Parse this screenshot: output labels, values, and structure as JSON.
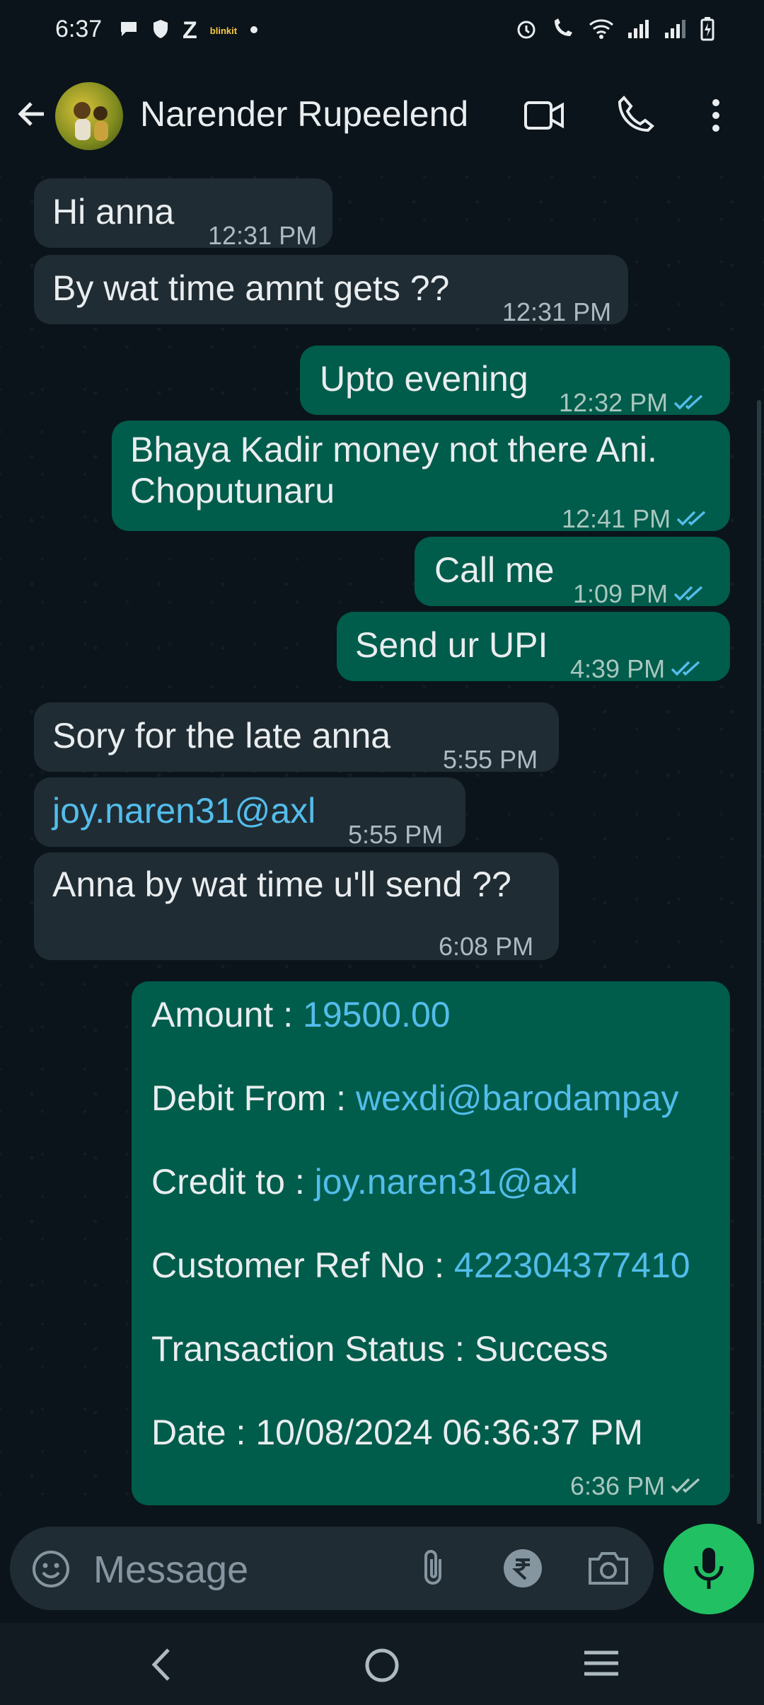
{
  "status_bar": {
    "time": "6:37",
    "left_icons": [
      "chat-bubble-icon",
      "shield-icon",
      "zomato-icon",
      "blinkit-icon",
      "dot-icon"
    ],
    "blinkit_label": "blinkit",
    "zomato_label": "Z",
    "right_icons": [
      "alarm-icon",
      "volte-call-icon",
      "wifi-icon",
      "signal-icon",
      "signal-icon",
      "battery-charging-icon"
    ]
  },
  "header": {
    "contact_name": "Narender Rupeelend",
    "icons": [
      "back-arrow-icon",
      "video-call-icon",
      "voice-call-icon",
      "more-vert-icon"
    ]
  },
  "messages": [
    {
      "dir": "in",
      "text": "Hi anna",
      "time": "12:31 PM"
    },
    {
      "dir": "in",
      "text": "By wat time amnt gets ??",
      "time": "12:31 PM"
    },
    {
      "dir": "out",
      "text": "Upto evening",
      "time": "12:32 PM",
      "status": "read"
    },
    {
      "dir": "out",
      "text": "Bhaya Kadir money not there Ani. Choputunaru",
      "line1": "Bhaya Kadir money not there Ani.",
      "line2": "Choputunaru",
      "time": "12:41 PM",
      "status": "read"
    },
    {
      "dir": "out",
      "text": "Call me",
      "time": "1:09 PM",
      "status": "read"
    },
    {
      "dir": "out",
      "text": "Send ur UPI",
      "time": "4:39 PM",
      "status": "read"
    },
    {
      "dir": "in",
      "text": "Sory for the late anna",
      "time": "5:55 PM"
    },
    {
      "dir": "in",
      "text": "joy.naren31@axl",
      "time": "5:55 PM"
    },
    {
      "dir": "in",
      "text": "Anna by wat time u'll send ??",
      "time": "6:08 PM"
    }
  ],
  "transaction": {
    "amount_label": "Amount :",
    "amount_value": "19500.00",
    "debit_label": "Debit From :",
    "debit_value": "wexdi@barodampay",
    "credit_label": "Credit to :",
    "credit_value": "joy.naren31@axl",
    "ref_label": "Customer Ref No :",
    "ref_value": "422304377410",
    "status_label": "Transaction Status :",
    "status_value": "Success",
    "date_label": "Date :",
    "date_value": "10/08/2024 06:36:37 PM",
    "time": "6:36 PM",
    "status": "delivered"
  },
  "composer": {
    "placeholder": "Message",
    "icons": [
      "emoji-icon",
      "attach-icon",
      "rupee-payment-icon",
      "camera-icon",
      "mic-icon"
    ]
  },
  "nav_bar": {
    "icons": [
      "nav-back-icon",
      "nav-home-icon",
      "nav-recents-icon"
    ]
  },
  "colors": {
    "background": "#0b141a",
    "incoming_bubble": "#202c33",
    "outgoing_bubble": "#005c4b",
    "link": "#53bdeb",
    "read_tick": "#53bdeb",
    "mic_button": "#21c063"
  }
}
